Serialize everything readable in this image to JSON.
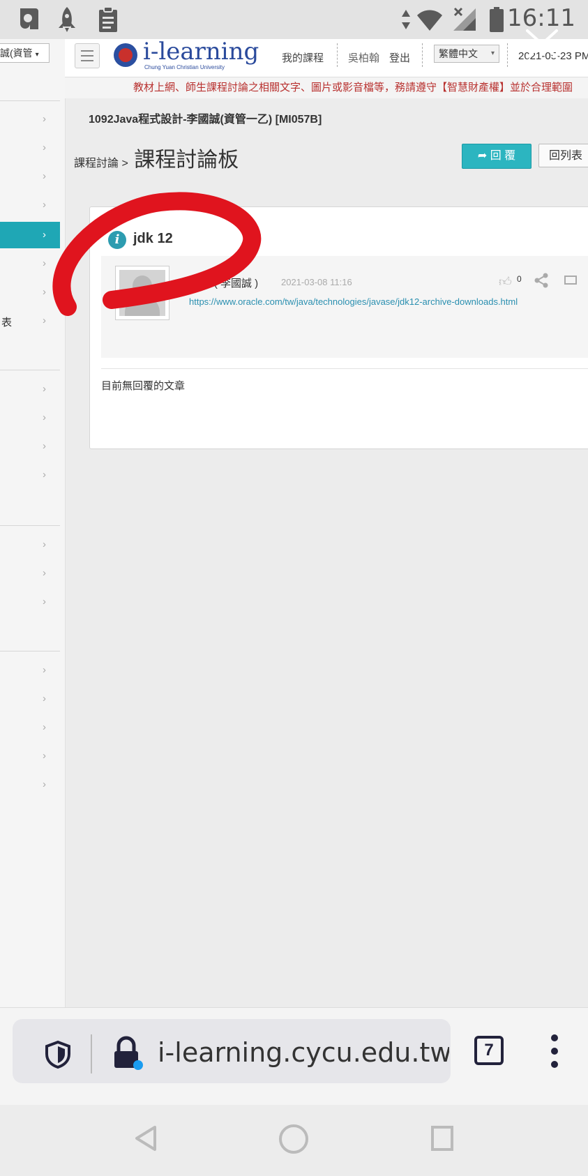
{
  "status_bar": {
    "time": "16:11",
    "icons": [
      "app-icon",
      "rocket-icon",
      "clipboard-icon",
      "data-arrows-icon",
      "wifi-icon",
      "signal-icon",
      "battery-icon"
    ]
  },
  "sidebar": {
    "user_select": "誠(資管",
    "items": [
      {
        "label": ""
      },
      {
        "label": ""
      },
      {
        "label": ""
      },
      {
        "label": ""
      },
      {
        "label": "",
        "active": true
      },
      {
        "label": ""
      },
      {
        "label": ""
      },
      {
        "label": "表"
      },
      {
        "label": ""
      },
      {
        "label": ""
      },
      {
        "label": ""
      },
      {
        "label": ""
      },
      {
        "label": ""
      },
      {
        "label": ""
      },
      {
        "label": ""
      },
      {
        "label": ""
      },
      {
        "label": ""
      },
      {
        "label": ""
      },
      {
        "label": ""
      },
      {
        "label": ""
      }
    ]
  },
  "header": {
    "logo_text": "i-learning",
    "logo_subtitle": "Chung Yuan Christian University",
    "my_courses": "我的課程",
    "user_name": "吳柏翰",
    "logout": "登出",
    "language": "繁體中文",
    "date": "2021-05-23 PM"
  },
  "notice": "教材上網、師生課程討論之相關文字、圖片或影音檔等，務請遵守【智慧財產權】並於合理範圍",
  "course_title": "1092Java程式設計-李國誠(資管一乙) [MI057B]",
  "breadcrumb": {
    "parent": "課程討論 >",
    "current": "課程討論板"
  },
  "buttons": {
    "reply": "回 覆",
    "back_to_list": "回列表"
  },
  "post": {
    "title": "jdk 12",
    "author": "…04 ( 李國誠 )",
    "date": "2021-03-08 11:16",
    "link": "https://www.oracle.com/tw/java/technologies/javase/jdk12-archive-downloads.html",
    "likes": "0",
    "no_replies": "目前無回覆的文章"
  },
  "browser": {
    "url": "i-learning.cycu.edu.tw/learn",
    "tab_count": "7"
  },
  "colors": {
    "accent": "#2cb5c0",
    "notice_red": "#b8312f",
    "scribble_red": "#e0141e",
    "link": "#2a8fb0"
  }
}
